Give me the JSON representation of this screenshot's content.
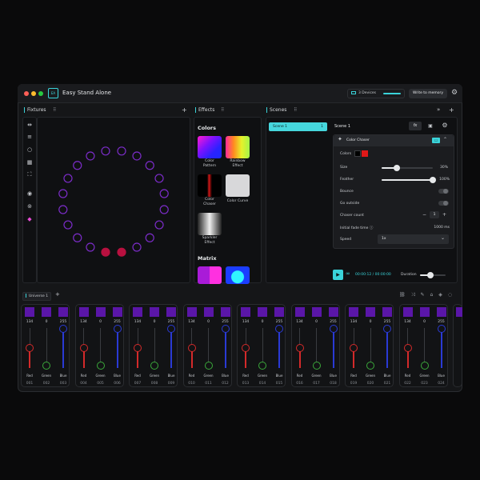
{
  "app": {
    "title": "Easy Stand Alone",
    "logo": "EA",
    "devices_label": "3 Devices",
    "write_label": "Write to memory",
    "traffic": [
      "#ff5f57",
      "#febc2e",
      "#28c840"
    ]
  },
  "fixtures": {
    "title": "Fixtures",
    "add": "+",
    "menu": "⠿",
    "tools": [
      "fit-icon",
      "distribute-icon",
      "circle-icon",
      "grid-icon",
      "expand-icon",
      "eye-icon",
      "group-icon",
      "palette-icon"
    ],
    "items": [
      {
        "color": "#7b2cc8",
        "selected": false
      },
      {
        "color": "#7b2cc8",
        "selected": false
      },
      {
        "color": "#7b2cc8",
        "selected": false
      },
      {
        "color": "#7b2cc8",
        "selected": false
      },
      {
        "color": "#7b2cc8",
        "selected": false
      },
      {
        "color": "#7b2cc8",
        "selected": false
      },
      {
        "color": "#7b2cc8",
        "selected": false
      },
      {
        "color": "#7b2cc8",
        "selected": false
      },
      {
        "color": "#7b2cc8",
        "selected": false
      },
      {
        "color": "#7b2cc8",
        "selected": false
      },
      {
        "color": "#b8103f",
        "selected": true
      },
      {
        "color": "#b8103f",
        "selected": true
      },
      {
        "color": "#7b2cc8",
        "selected": false
      },
      {
        "color": "#7b2cc8",
        "selected": false
      },
      {
        "color": "#7b2cc8",
        "selected": false
      },
      {
        "color": "#7b2cc8",
        "selected": false
      },
      {
        "color": "#7b2cc8",
        "selected": false
      },
      {
        "color": "#7b2cc8",
        "selected": false
      },
      {
        "color": "#7b2cc8",
        "selected": false
      },
      {
        "color": "#7b2cc8",
        "selected": false
      }
    ]
  },
  "effects": {
    "title": "Effects",
    "menu": "⠿",
    "colors_heading": "Colors",
    "matrix_heading": "Matrix",
    "items": [
      {
        "label1": "Color",
        "label2": "Pattern"
      },
      {
        "label1": "Rainbow",
        "label2": "Effect"
      },
      {
        "label1": "Color",
        "label2": "Chaser"
      },
      {
        "label1": "Color Curve",
        "label2": ""
      },
      {
        "label1": "Sparkler",
        "label2": "Effect"
      }
    ]
  },
  "scenes": {
    "title": "Scenes",
    "menu": "⠿",
    "add": "+",
    "skip": "»",
    "list": [
      {
        "name": "Scene 1",
        "num": "1"
      }
    ],
    "current": "Scene 1",
    "fx_label": "fx",
    "effect": {
      "name": "Color Chaser",
      "chip": "☐",
      "colors_label": "Colors",
      "colors": [
        "#000000",
        "#e01818"
      ],
      "size_label": "Size",
      "size_value": "30%",
      "size_pct": 30,
      "feather_label": "Feather",
      "feather_value": "100%",
      "feather_pct": 100,
      "bounce_label": "Bounce",
      "outside_label": "Go outside",
      "count_label": "Chaser count",
      "count_value": "1",
      "minus": "−",
      "plus": "+",
      "fade_label": "Initial fade time ⓘ",
      "fade_value": "1000 ms",
      "speed_label": "Speed",
      "speed_value": "1x"
    },
    "time": "00:00:12 / 00:00:00",
    "duration_label": "Duration",
    "duration_pct": 40
  },
  "universe": {
    "tab": "Universe 1",
    "add": "+",
    "channels": [
      {
        "red": "134",
        "green": "0",
        "blue": "255",
        "n": [
          "001",
          "002",
          "003"
        ]
      },
      {
        "red": "134",
        "green": "0",
        "blue": "255",
        "n": [
          "004",
          "005",
          "006"
        ]
      },
      {
        "red": "134",
        "green": "0",
        "blue": "255",
        "n": [
          "007",
          "008",
          "009"
        ]
      },
      {
        "red": "134",
        "green": "0",
        "blue": "255",
        "n": [
          "010",
          "011",
          "012"
        ]
      },
      {
        "red": "134",
        "green": "0",
        "blue": "255",
        "n": [
          "013",
          "014",
          "015"
        ]
      },
      {
        "red": "134",
        "green": "0",
        "blue": "255",
        "n": [
          "016",
          "017",
          "018"
        ]
      },
      {
        "red": "134",
        "green": "0",
        "blue": "255",
        "n": [
          "019",
          "020",
          "021"
        ]
      },
      {
        "red": "134",
        "green": "0",
        "blue": "255",
        "n": [
          "022",
          "023",
          "024"
        ]
      }
    ],
    "labels": {
      "red": "Red",
      "green": "Green",
      "blue": "Blue"
    }
  }
}
